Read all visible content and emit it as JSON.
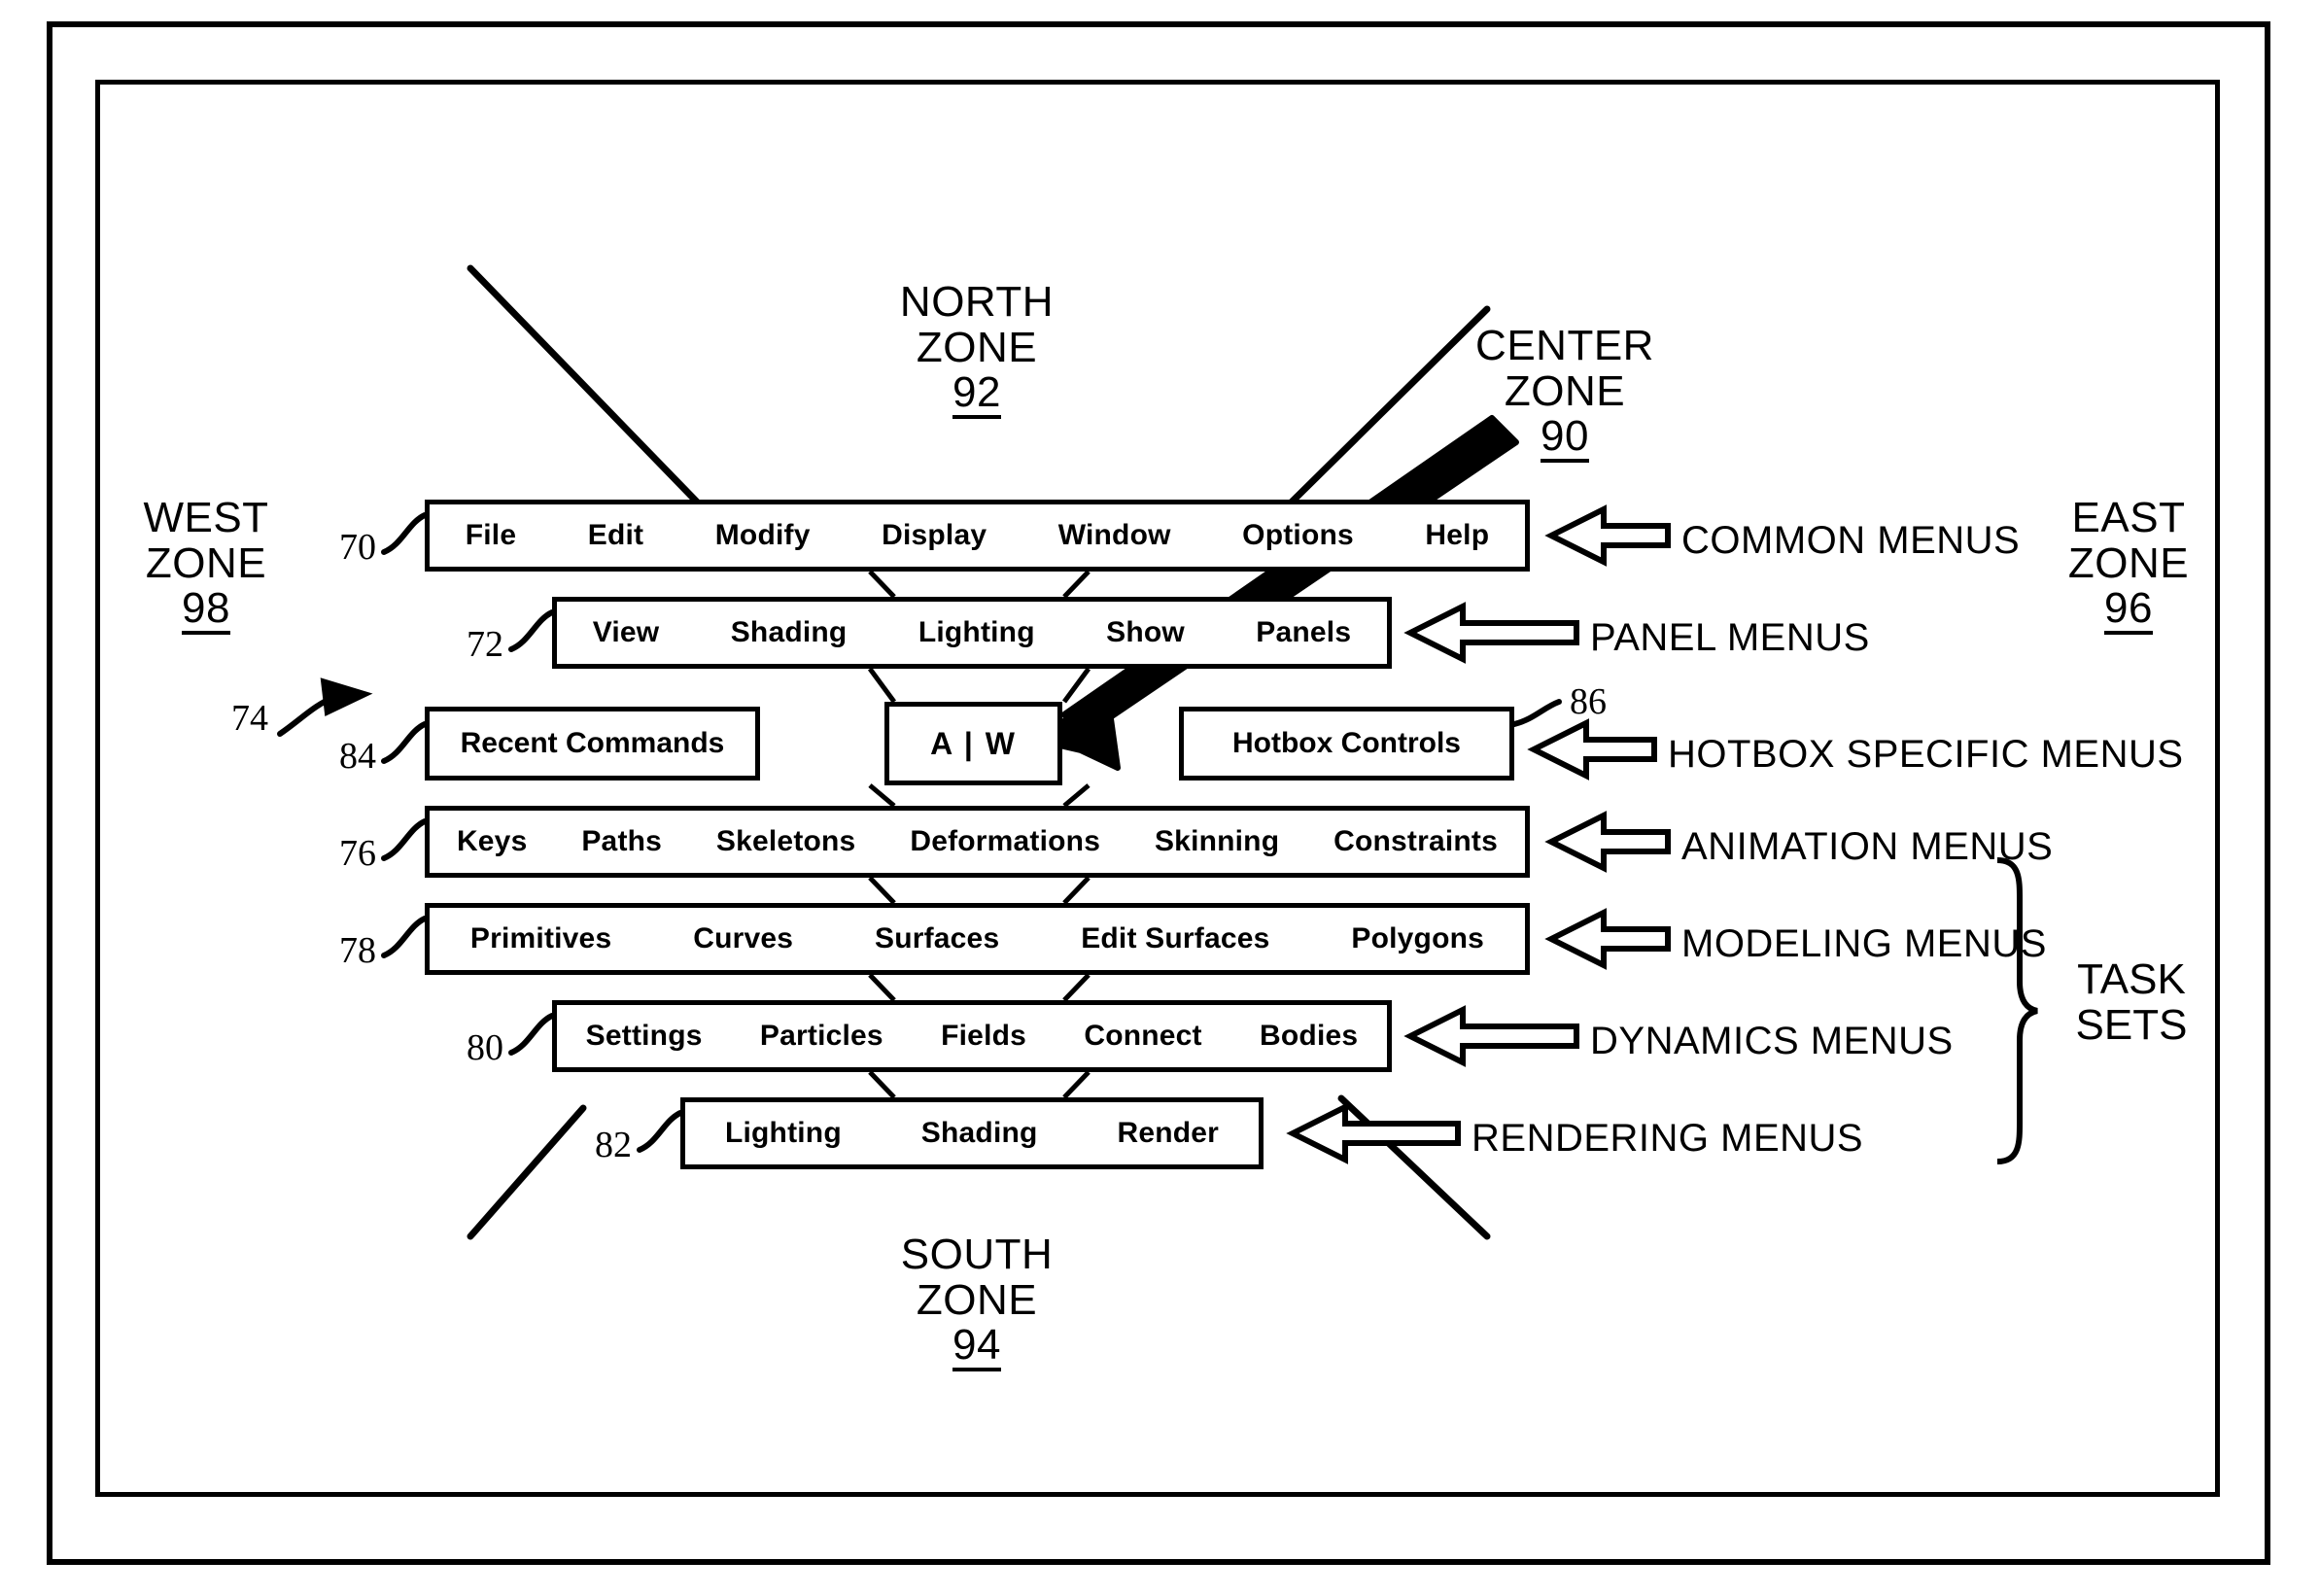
{
  "figure": {
    "title": "Hotbox menu zone layout diagram"
  },
  "menu_bars": [
    {
      "ref": "70",
      "name": "common-menus",
      "items": [
        "File",
        "Edit",
        "Modify",
        "Display",
        "Window",
        "Options",
        "Help"
      ]
    },
    {
      "ref": "72",
      "name": "panel-menus",
      "items": [
        "View",
        "Shading",
        "Lighting",
        "Show",
        "Panels"
      ]
    },
    {
      "ref": "76",
      "name": "animation-menus",
      "items": [
        "Keys",
        "Paths",
        "Skeletons",
        "Deformations",
        "Skinning",
        "Constraints"
      ]
    },
    {
      "ref": "78",
      "name": "modeling-menus",
      "items": [
        "Primitives",
        "Curves",
        "Surfaces",
        "Edit Surfaces",
        "Polygons"
      ]
    },
    {
      "ref": "80",
      "name": "dynamics-menus",
      "items": [
        "Settings",
        "Particles",
        "Fields",
        "Connect",
        "Bodies"
      ]
    },
    {
      "ref": "82",
      "name": "rendering-menus",
      "items": [
        "Lighting",
        "Shading",
        "Render"
      ]
    }
  ],
  "hotbox_row": {
    "ref": "74",
    "recent": {
      "ref": "84",
      "label": "Recent Commands"
    },
    "center": {
      "label": "A | W"
    },
    "controls": {
      "ref": "86",
      "label": "Hotbox Controls"
    }
  },
  "zones": {
    "north": {
      "line1": "NORTH",
      "line2": "ZONE",
      "num": "92"
    },
    "south": {
      "line1": "SOUTH",
      "line2": "ZONE",
      "num": "94"
    },
    "east": {
      "line1": "EAST",
      "line2": "ZONE",
      "num": "96"
    },
    "west": {
      "line1": "WEST",
      "line2": "ZONE",
      "num": "98"
    },
    "center": {
      "line1": "CENTER",
      "line2": "ZONE",
      "num": "90"
    }
  },
  "annotations": [
    {
      "name": "common-menus-annotation",
      "label": "COMMON MENUS"
    },
    {
      "name": "panel-menus-annotation",
      "label": "PANEL MENUS"
    },
    {
      "name": "hotbox-specific-annotation",
      "label": "HOTBOX SPECIFIC MENUS"
    },
    {
      "name": "animation-menus-annotation",
      "label": "ANIMATION MENUS"
    },
    {
      "name": "modeling-menus-annotation",
      "label": "MODELING MENUS"
    },
    {
      "name": "dynamics-menus-annotation",
      "label": "DYNAMICS MENUS"
    },
    {
      "name": "rendering-menus-annotation",
      "label": "RENDERING MENUS"
    }
  ],
  "task_sets": {
    "line1": "TASK",
    "line2": "SETS"
  },
  "refnums": {
    "r70": "70",
    "r72": "72",
    "r74": "74",
    "r76": "76",
    "r78": "78",
    "r80": "80",
    "r82": "82",
    "r84": "84",
    "r86": "86"
  },
  "colors": {
    "ink": "#000000",
    "paper": "#ffffff"
  }
}
